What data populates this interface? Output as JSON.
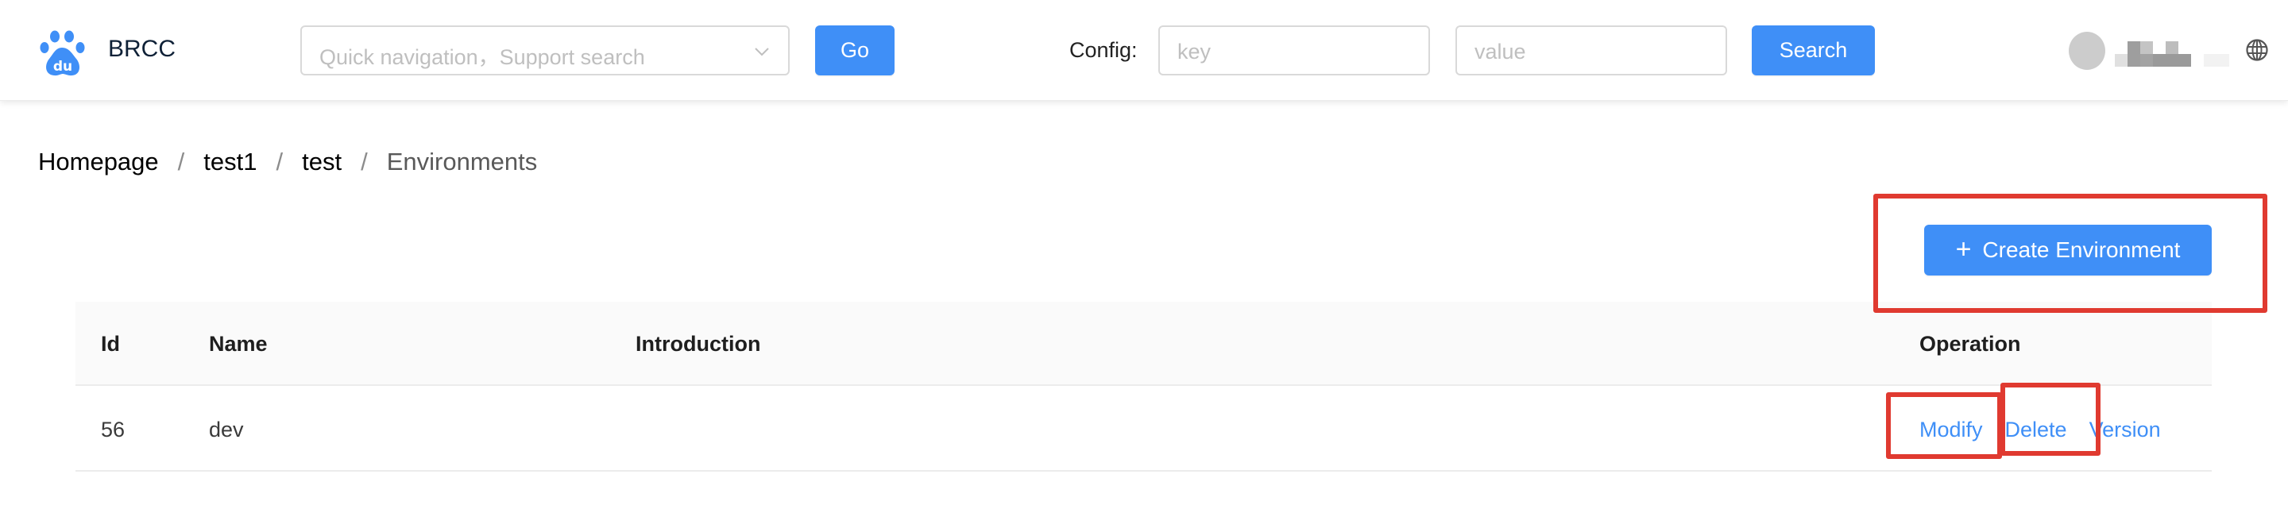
{
  "header": {
    "brand": "BRCC",
    "logo_icon": "baidu-paw-logo",
    "quick_nav": {
      "placeholder": "Quick navigation，Support search",
      "icon": "chevron-down-icon"
    },
    "go_label": "Go",
    "config_label": "Config:",
    "key_input": {
      "placeholder": "key",
      "value": ""
    },
    "value_input": {
      "placeholder": "value",
      "value": ""
    },
    "search_label": "Search",
    "user": {
      "avatar": "avatar-placeholder",
      "name": "(blurred)"
    },
    "language_icon": "globe-icon"
  },
  "breadcrumb": {
    "items": [
      "Homepage",
      "test1",
      "test",
      "Environments"
    ],
    "separator": "/"
  },
  "actions": {
    "create_label": "Create Environment",
    "create_icon": "plus-icon"
  },
  "table": {
    "columns": [
      "Id",
      "Name",
      "Introduction",
      "Operation"
    ],
    "rows": [
      {
        "id": "56",
        "name": "dev",
        "introduction": "",
        "operations": [
          "Modify",
          "Delete",
          "Version"
        ]
      }
    ]
  },
  "colors": {
    "primary": "#3f8ff7",
    "highlight": "#e03a30",
    "header_bg": "#fafafa"
  }
}
